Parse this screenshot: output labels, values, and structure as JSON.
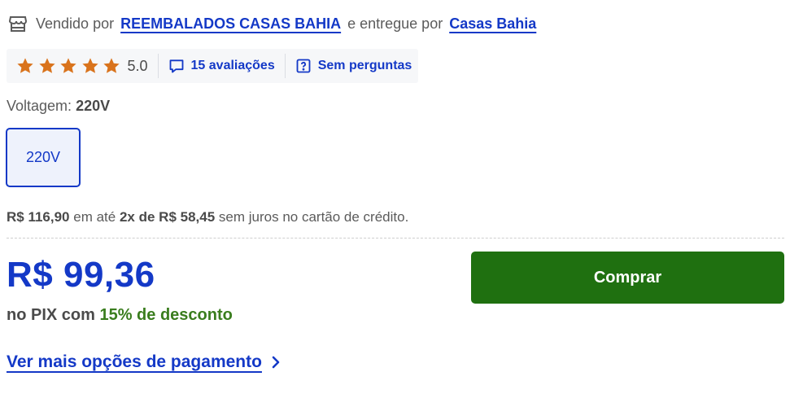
{
  "seller": {
    "prefix": "Vendido por",
    "seller_name": "REEMBALADOS CASAS BAHIA",
    "middle": "e entregue por",
    "delivery_name": "Casas Bahia"
  },
  "rating": {
    "stars": 5,
    "value": "5.0",
    "reviews_label": "15 avaliações",
    "questions_label": "Sem perguntas"
  },
  "voltage": {
    "label": "Voltagem:",
    "selected": "220V",
    "options": [
      "220V"
    ]
  },
  "installments": {
    "full_price": "R$ 116,90",
    "text1": "em até",
    "plan": "2x de R$ 58,45",
    "text2": "sem juros no cartão de crédito."
  },
  "price": {
    "value": "R$ 99,36",
    "pix_prefix": "no PIX com",
    "discount": "15% de desconto"
  },
  "actions": {
    "buy_label": "Comprar",
    "more_payment_label": "Ver mais opções de pagamento"
  },
  "colors": {
    "link_blue": "#1439c7",
    "star_orange": "#d9731c",
    "buy_green": "#1f7010",
    "discount_green": "#3a7d1e"
  }
}
